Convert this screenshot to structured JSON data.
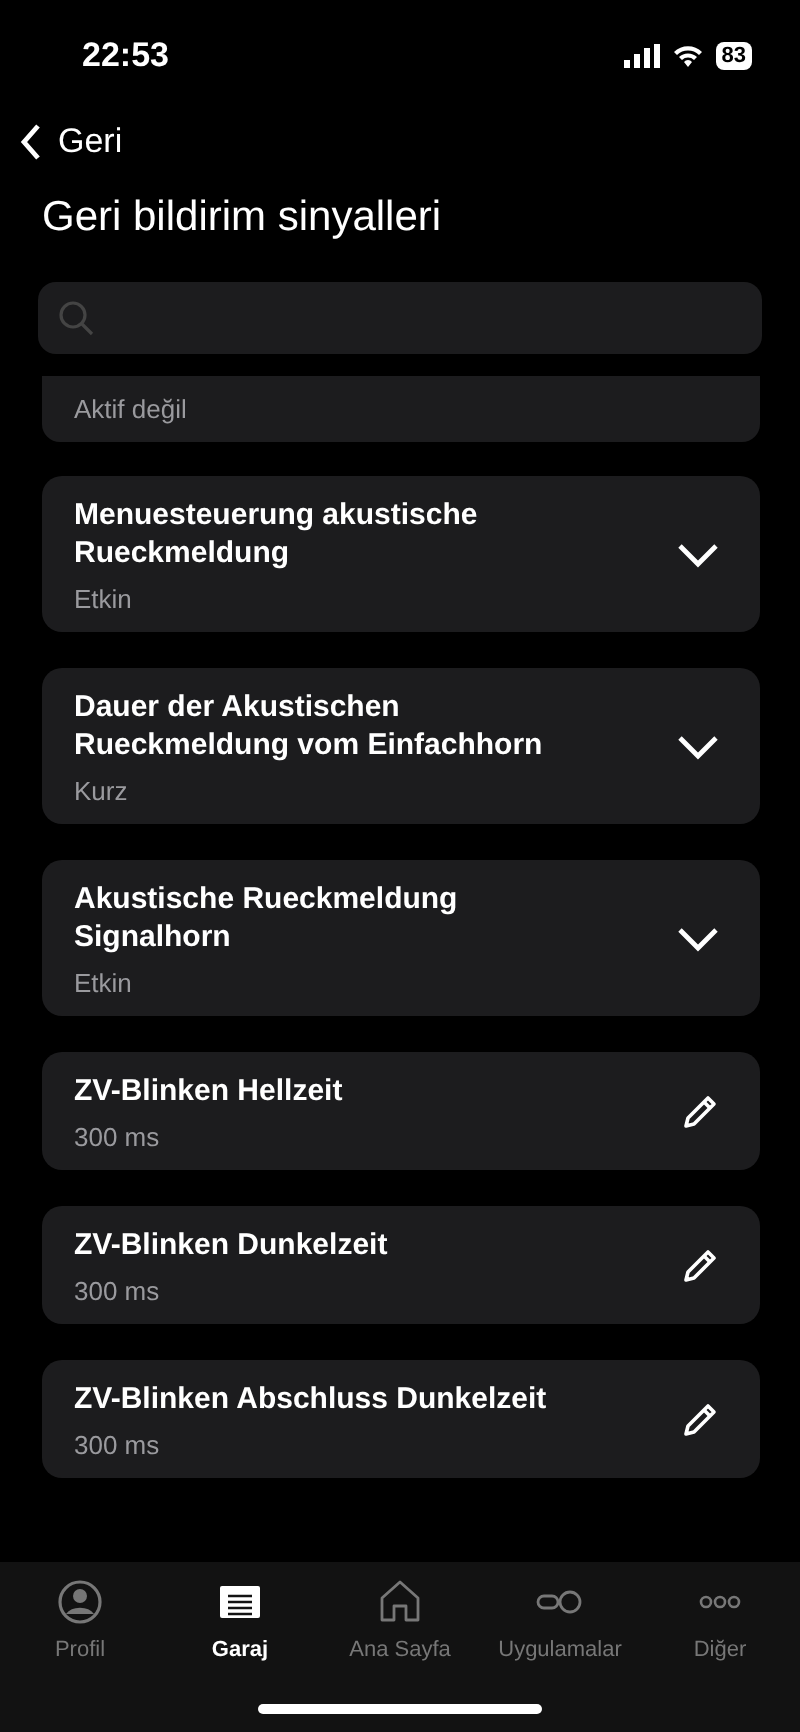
{
  "status_bar": {
    "time": "22:53",
    "battery": "83"
  },
  "nav": {
    "back": "Geri",
    "title": "Geri bildirim sinyalleri"
  },
  "partial_item": {
    "value": "Aktif değil"
  },
  "items": [
    {
      "kind": "dropdown",
      "title": "Menuesteuerung akustische Rueckmeldung",
      "value": "Etkin"
    },
    {
      "kind": "dropdown",
      "title": "Dauer der Akustischen Rueckmeldung vom Einfachhorn",
      "value": "Kurz"
    },
    {
      "kind": "dropdown",
      "title": "Akustische Rueckmeldung Signalhorn",
      "value": "Etkin"
    },
    {
      "kind": "edit",
      "title": "ZV-Blinken Hellzeit",
      "value": "300 ms"
    },
    {
      "kind": "edit",
      "title": "ZV-Blinken Dunkelzeit",
      "value": "300 ms"
    },
    {
      "kind": "edit",
      "title": "ZV-Blinken Abschluss Dunkelzeit",
      "value": "300 ms"
    }
  ],
  "tab_bar": [
    {
      "kind": "profile",
      "label": "Profil",
      "selected": false
    },
    {
      "kind": "garage",
      "label": "Garaj",
      "selected": true
    },
    {
      "kind": "home",
      "label": "Ana Sayfa",
      "selected": false
    },
    {
      "kind": "apps",
      "label": "Uygulamalar",
      "selected": false
    },
    {
      "kind": "more",
      "label": "Diğer",
      "selected": false
    }
  ]
}
